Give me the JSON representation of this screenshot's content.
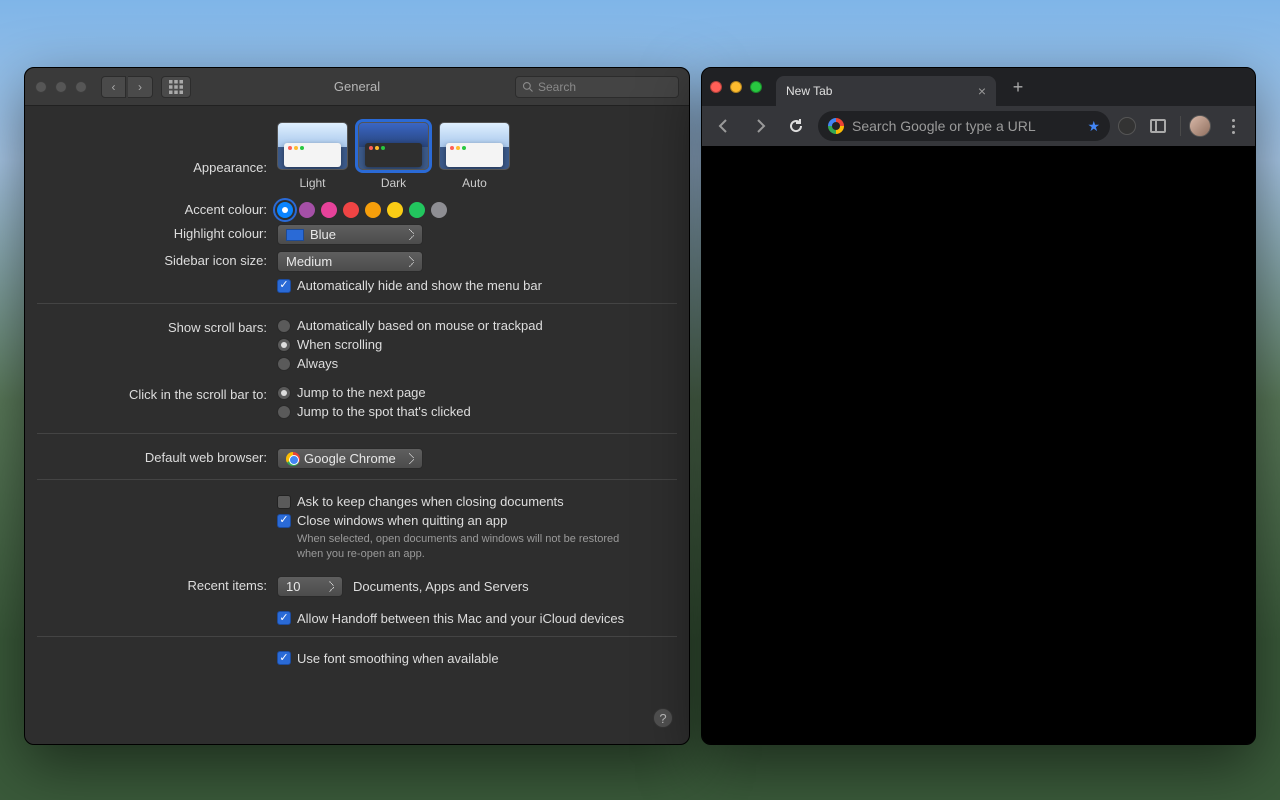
{
  "prefs": {
    "title": "General",
    "search_placeholder": "Search",
    "appearance": {
      "label": "Appearance:",
      "options": [
        "Light",
        "Dark",
        "Auto"
      ],
      "selected": "Dark"
    },
    "accent": {
      "label": "Accent colour:",
      "colors": [
        "#0a84ff",
        "#a550a7",
        "#e6429a",
        "#ef4444",
        "#f59e0b",
        "#facc15",
        "#22c55e",
        "#8e8e93"
      ],
      "selected_index": 0
    },
    "highlight": {
      "label": "Highlight colour:",
      "value": "Blue"
    },
    "sidebar_size": {
      "label": "Sidebar icon size:",
      "value": "Medium"
    },
    "autohide_menu": {
      "label": "Automatically hide and show the menu bar",
      "checked": true
    },
    "scrollbars": {
      "label": "Show scroll bars:",
      "options": [
        "Automatically based on mouse or trackpad",
        "When scrolling",
        "Always"
      ],
      "selected_index": 1
    },
    "click_scroll": {
      "label": "Click in the scroll bar to:",
      "options": [
        "Jump to the next page",
        "Jump to the spot that's clicked"
      ],
      "selected_index": 0
    },
    "default_browser": {
      "label": "Default web browser:",
      "value": "Google Chrome"
    },
    "ask_keep": {
      "label": "Ask to keep changes when closing documents",
      "checked": false
    },
    "close_windows": {
      "label": "Close windows when quitting an app",
      "checked": true,
      "hint": "When selected, open documents and windows will not be restored when you re-open an app."
    },
    "recent": {
      "label": "Recent items:",
      "value": "10",
      "suffix": "Documents, Apps and Servers"
    },
    "handoff": {
      "label": "Allow Handoff between this Mac and your iCloud devices",
      "checked": true
    },
    "font_smoothing": {
      "label": "Use font smoothing when available",
      "checked": true
    }
  },
  "chrome": {
    "tab_title": "New Tab",
    "omnibox_placeholder": "Search Google or type a URL"
  }
}
